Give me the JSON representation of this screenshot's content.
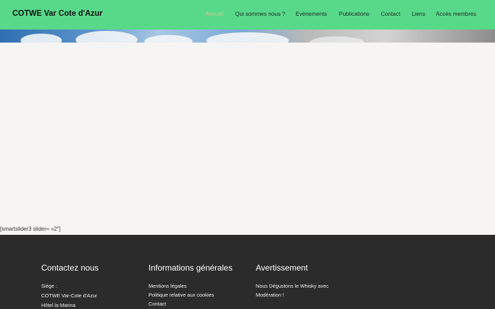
{
  "header": {
    "site_title": "COTWE Var Cote d'Azur",
    "nav": [
      {
        "label": "Accueil"
      },
      {
        "label": "Qui sommes nous ?"
      },
      {
        "label": "Evènements"
      },
      {
        "label": "Publications"
      },
      {
        "label": "Contact"
      },
      {
        "label": "Liens"
      },
      {
        "label": "Accès membres"
      }
    ]
  },
  "main": {
    "shortcode_text": "[smartslider3 slider= »2″]"
  },
  "footer": {
    "contact": {
      "heading": "Contactez nous",
      "lines": [
        "Siège :",
        "COTWE Var-Cote d'Azur",
        "Hôtel la Marina"
      ]
    },
    "info": {
      "heading": "Informations générales",
      "links": [
        "Mentions légales",
        "Politique relative aux cookies",
        "Contact"
      ]
    },
    "warning": {
      "heading": "Avertissement",
      "lines": [
        "Nous Dégustons le Whisky avec",
        "Modération !"
      ]
    }
  },
  "colors": {
    "header_bg": "#58d98a",
    "active_nav": "#d9c38a",
    "footer_bg": "#2b2b2b",
    "page_bg": "#f7f5f4"
  }
}
